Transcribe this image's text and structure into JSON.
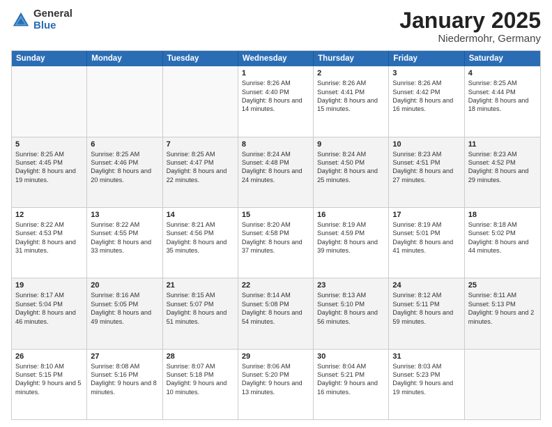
{
  "logo": {
    "general": "General",
    "blue": "Blue"
  },
  "title": "January 2025",
  "subtitle": "Niedermohr, Germany",
  "days": [
    "Sunday",
    "Monday",
    "Tuesday",
    "Wednesday",
    "Thursday",
    "Friday",
    "Saturday"
  ],
  "rows": [
    [
      {
        "day": "",
        "empty": true
      },
      {
        "day": "",
        "empty": true
      },
      {
        "day": "",
        "empty": true
      },
      {
        "day": "1",
        "sunrise": "8:26 AM",
        "sunset": "4:40 PM",
        "daylight": "8 hours and 14 minutes."
      },
      {
        "day": "2",
        "sunrise": "8:26 AM",
        "sunset": "4:41 PM",
        "daylight": "8 hours and 15 minutes."
      },
      {
        "day": "3",
        "sunrise": "8:26 AM",
        "sunset": "4:42 PM",
        "daylight": "8 hours and 16 minutes."
      },
      {
        "day": "4",
        "sunrise": "8:25 AM",
        "sunset": "4:44 PM",
        "daylight": "8 hours and 18 minutes."
      }
    ],
    [
      {
        "day": "5",
        "sunrise": "8:25 AM",
        "sunset": "4:45 PM",
        "daylight": "8 hours and 19 minutes."
      },
      {
        "day": "6",
        "sunrise": "8:25 AM",
        "sunset": "4:46 PM",
        "daylight": "8 hours and 20 minutes."
      },
      {
        "day": "7",
        "sunrise": "8:25 AM",
        "sunset": "4:47 PM",
        "daylight": "8 hours and 22 minutes."
      },
      {
        "day": "8",
        "sunrise": "8:24 AM",
        "sunset": "4:48 PM",
        "daylight": "8 hours and 24 minutes."
      },
      {
        "day": "9",
        "sunrise": "8:24 AM",
        "sunset": "4:50 PM",
        "daylight": "8 hours and 25 minutes."
      },
      {
        "day": "10",
        "sunrise": "8:23 AM",
        "sunset": "4:51 PM",
        "daylight": "8 hours and 27 minutes."
      },
      {
        "day": "11",
        "sunrise": "8:23 AM",
        "sunset": "4:52 PM",
        "daylight": "8 hours and 29 minutes."
      }
    ],
    [
      {
        "day": "12",
        "sunrise": "8:22 AM",
        "sunset": "4:53 PM",
        "daylight": "8 hours and 31 minutes."
      },
      {
        "day": "13",
        "sunrise": "8:22 AM",
        "sunset": "4:55 PM",
        "daylight": "8 hours and 33 minutes."
      },
      {
        "day": "14",
        "sunrise": "8:21 AM",
        "sunset": "4:56 PM",
        "daylight": "8 hours and 35 minutes."
      },
      {
        "day": "15",
        "sunrise": "8:20 AM",
        "sunset": "4:58 PM",
        "daylight": "8 hours and 37 minutes."
      },
      {
        "day": "16",
        "sunrise": "8:19 AM",
        "sunset": "4:59 PM",
        "daylight": "8 hours and 39 minutes."
      },
      {
        "day": "17",
        "sunrise": "8:19 AM",
        "sunset": "5:01 PM",
        "daylight": "8 hours and 41 minutes."
      },
      {
        "day": "18",
        "sunrise": "8:18 AM",
        "sunset": "5:02 PM",
        "daylight": "8 hours and 44 minutes."
      }
    ],
    [
      {
        "day": "19",
        "sunrise": "8:17 AM",
        "sunset": "5:04 PM",
        "daylight": "8 hours and 46 minutes."
      },
      {
        "day": "20",
        "sunrise": "8:16 AM",
        "sunset": "5:05 PM",
        "daylight": "8 hours and 49 minutes."
      },
      {
        "day": "21",
        "sunrise": "8:15 AM",
        "sunset": "5:07 PM",
        "daylight": "8 hours and 51 minutes."
      },
      {
        "day": "22",
        "sunrise": "8:14 AM",
        "sunset": "5:08 PM",
        "daylight": "8 hours and 54 minutes."
      },
      {
        "day": "23",
        "sunrise": "8:13 AM",
        "sunset": "5:10 PM",
        "daylight": "8 hours and 56 minutes."
      },
      {
        "day": "24",
        "sunrise": "8:12 AM",
        "sunset": "5:11 PM",
        "daylight": "8 hours and 59 minutes."
      },
      {
        "day": "25",
        "sunrise": "8:11 AM",
        "sunset": "5:13 PM",
        "daylight": "9 hours and 2 minutes."
      }
    ],
    [
      {
        "day": "26",
        "sunrise": "8:10 AM",
        "sunset": "5:15 PM",
        "daylight": "9 hours and 5 minutes."
      },
      {
        "day": "27",
        "sunrise": "8:08 AM",
        "sunset": "5:16 PM",
        "daylight": "9 hours and 8 minutes."
      },
      {
        "day": "28",
        "sunrise": "8:07 AM",
        "sunset": "5:18 PM",
        "daylight": "9 hours and 10 minutes."
      },
      {
        "day": "29",
        "sunrise": "8:06 AM",
        "sunset": "5:20 PM",
        "daylight": "9 hours and 13 minutes."
      },
      {
        "day": "30",
        "sunrise": "8:04 AM",
        "sunset": "5:21 PM",
        "daylight": "9 hours and 16 minutes."
      },
      {
        "day": "31",
        "sunrise": "8:03 AM",
        "sunset": "5:23 PM",
        "daylight": "9 hours and 19 minutes."
      },
      {
        "day": "",
        "empty": true
      }
    ]
  ]
}
